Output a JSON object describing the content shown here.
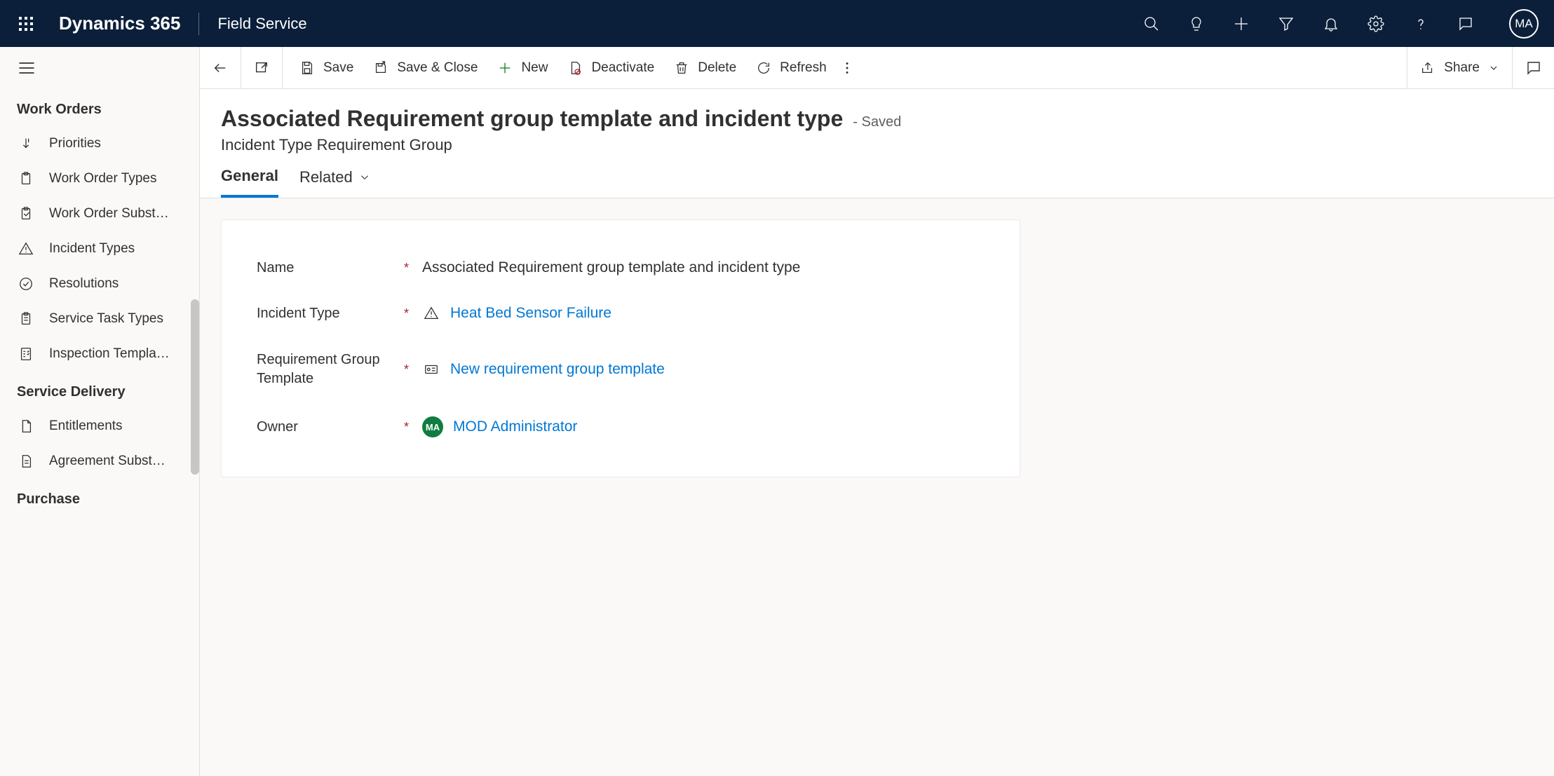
{
  "header": {
    "brand": "Dynamics 365",
    "module": "Field Service",
    "avatar_initials": "MA"
  },
  "sidebar": {
    "group1_title": "Work Orders",
    "group1_items": [
      "Priorities",
      "Work Order Types",
      "Work Order Subst…",
      "Incident Types",
      "Resolutions",
      "Service Task Types",
      "Inspection Templa…"
    ],
    "group2_title": "Service Delivery",
    "group2_items": [
      "Entitlements",
      "Agreement Subst…"
    ],
    "group3_title": "Purchase"
  },
  "commands": {
    "save": "Save",
    "save_close": "Save & Close",
    "new": "New",
    "deactivate": "Deactivate",
    "delete": "Delete",
    "refresh": "Refresh",
    "share": "Share"
  },
  "record": {
    "title": "Associated Requirement group template and incident type",
    "saved_status": "- Saved",
    "subtitle": "Incident Type Requirement Group"
  },
  "tabs": {
    "general": "General",
    "related": "Related"
  },
  "form": {
    "name_label": "Name",
    "name_value": "Associated Requirement group template and incident type",
    "incident_type_label": "Incident Type",
    "incident_type_value": "Heat Bed Sensor Failure",
    "rgt_label_line1": "Requirement Group",
    "rgt_label_line2": "Template",
    "rgt_value": "New requirement group template",
    "owner_label": "Owner",
    "owner_initials": "MA",
    "owner_value": "MOD Administrator"
  }
}
